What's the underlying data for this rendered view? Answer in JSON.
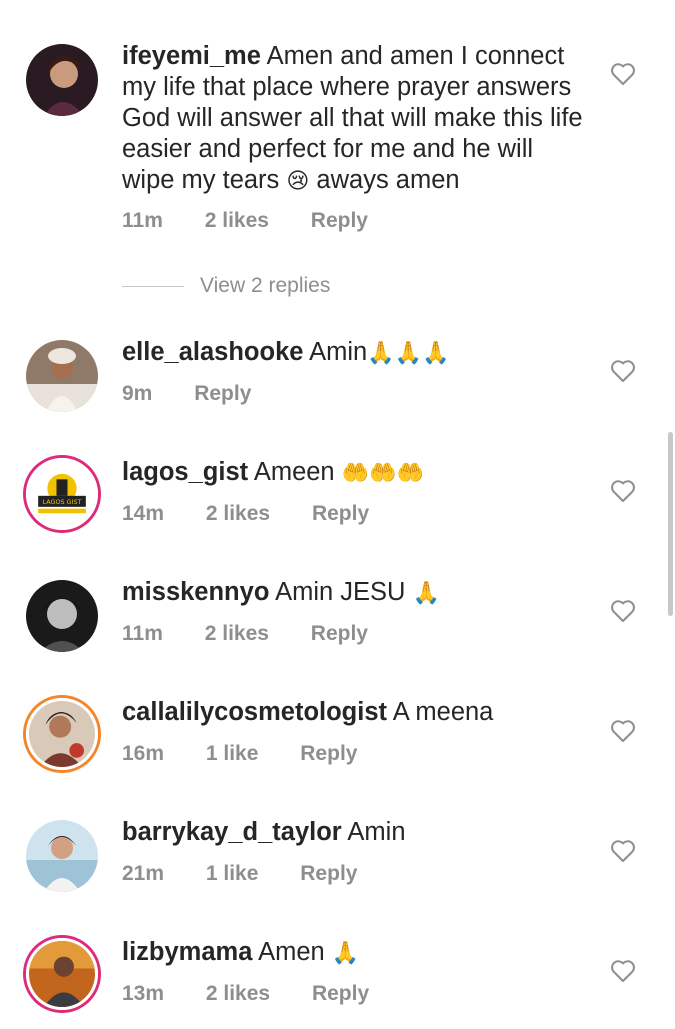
{
  "comments": [
    {
      "username": "ifeyemi_me",
      "text": "Amen and amen I connect my life that place where prayer answers God will answer all that will make this life easier and perfect for me and he will wipe my tears",
      "emoji": "😢",
      "text_after": " aways amen",
      "time": "11m",
      "likes": "2 likes",
      "reply": "Reply"
    },
    {
      "username": "elle_alashooke",
      "text": "Amin",
      "emoji": "🙏🙏🙏",
      "time": "9m",
      "likes": "",
      "reply": "Reply"
    },
    {
      "username": "lagos_gist",
      "text": "Ameen",
      "emoji": "🤲🤲🤲",
      "time": "14m",
      "likes": "2 likes",
      "reply": "Reply",
      "avatar_text": "LAGOS GIST"
    },
    {
      "username": "misskennyo",
      "text": "Amin JESU",
      "emoji": "🙏",
      "time": "11m",
      "likes": "2 likes",
      "reply": "Reply"
    },
    {
      "username": "callalilycosmetologist",
      "text": "A meena",
      "emoji": "",
      "time": "16m",
      "likes": "1 like",
      "reply": "Reply"
    },
    {
      "username": "barrykay_d_taylor",
      "text": "Amin",
      "emoji": "",
      "time": "21m",
      "likes": "1 like",
      "reply": "Reply"
    },
    {
      "username": "lizbymama",
      "text": "Amen",
      "emoji": "🙏",
      "time": "13m",
      "likes": "2 likes",
      "reply": "Reply"
    }
  ],
  "view_replies": "View 2 replies",
  "colors": {
    "text": "#262626",
    "secondary": "#8e8e8e",
    "story_ring": "#dd2a7b"
  },
  "icons": {
    "like": "heart-outline-icon"
  }
}
